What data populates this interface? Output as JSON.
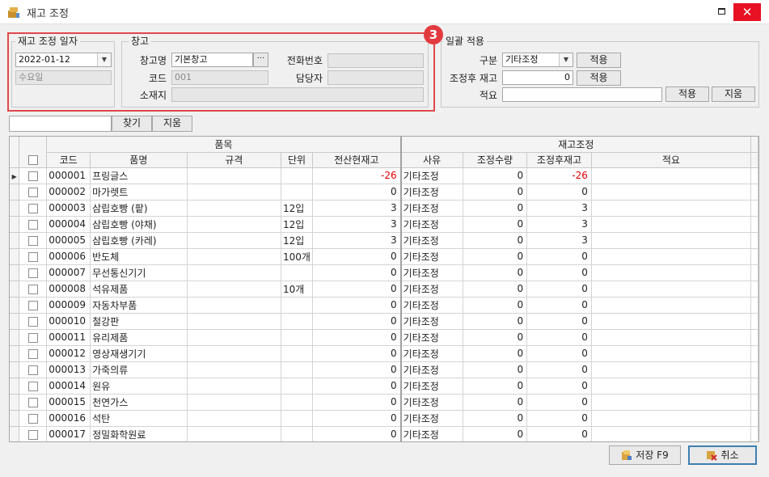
{
  "window": {
    "title": "재고 조정",
    "close_glyph": "✕"
  },
  "date_group": {
    "legend": "재고 조정 일자",
    "date_value": "2022-01-12",
    "weekday": "수요일"
  },
  "warehouse_group": {
    "legend": "창고",
    "name_label": "창고명",
    "name_value": "기본창고",
    "browse_glyph": "···",
    "phone_label": "전화번호",
    "phone_value": "",
    "code_label": "코드",
    "code_value": "001",
    "manager_label": "담당자",
    "manager_value": "",
    "location_label": "소재지",
    "location_value": ""
  },
  "badge": "3",
  "batch_group": {
    "legend": "일괄 적용",
    "category_label": "구분",
    "category_value": "기타조정",
    "apply_label": "적용",
    "after_stock_label": "조정후 재고",
    "after_stock_value": "0",
    "apply2_label": "적용",
    "memo_label": "적요",
    "memo_value": "",
    "apply3_label": "적용",
    "clear_label": "지움"
  },
  "search": {
    "value": "",
    "find_label": "찾기",
    "clear_label": "지움"
  },
  "grid": {
    "group_item": "품목",
    "group_adjust": "재고조정",
    "columns": [
      "코드",
      "품명",
      "규격",
      "단위",
      "전산현재고",
      "사유",
      "조정수량",
      "조정후재고",
      "적요"
    ],
    "rows": [
      {
        "code": "000001",
        "name": "프링글스",
        "spec": "",
        "unit": "",
        "stock": "-26",
        "reason": "기타조정",
        "qty": "0",
        "after": "-26",
        "memo": ""
      },
      {
        "code": "000002",
        "name": "마가렛트",
        "spec": "",
        "unit": "",
        "stock": "0",
        "reason": "기타조정",
        "qty": "0",
        "after": "0",
        "memo": ""
      },
      {
        "code": "000003",
        "name": "삼립호빵 (팥)",
        "spec": "",
        "unit": "12입",
        "stock": "3",
        "reason": "기타조정",
        "qty": "0",
        "after": "3",
        "memo": ""
      },
      {
        "code": "000004",
        "name": "삼립호빵 (야채)",
        "spec": "",
        "unit": "12입",
        "stock": "3",
        "reason": "기타조정",
        "qty": "0",
        "after": "3",
        "memo": ""
      },
      {
        "code": "000005",
        "name": "삼립호빵 (카레)",
        "spec": "",
        "unit": "12입",
        "stock": "3",
        "reason": "기타조정",
        "qty": "0",
        "after": "3",
        "memo": ""
      },
      {
        "code": "000006",
        "name": "반도체",
        "spec": "",
        "unit": "100개",
        "stock": "0",
        "reason": "기타조정",
        "qty": "0",
        "after": "0",
        "memo": ""
      },
      {
        "code": "000007",
        "name": "무선통신기기",
        "spec": "",
        "unit": "",
        "stock": "0",
        "reason": "기타조정",
        "qty": "0",
        "after": "0",
        "memo": ""
      },
      {
        "code": "000008",
        "name": "석유제품",
        "spec": "",
        "unit": "10개",
        "stock": "0",
        "reason": "기타조정",
        "qty": "0",
        "after": "0",
        "memo": ""
      },
      {
        "code": "000009",
        "name": "자동차부품",
        "spec": "",
        "unit": "",
        "stock": "0",
        "reason": "기타조정",
        "qty": "0",
        "after": "0",
        "memo": ""
      },
      {
        "code": "000010",
        "name": "철강판",
        "spec": "",
        "unit": "",
        "stock": "0",
        "reason": "기타조정",
        "qty": "0",
        "after": "0",
        "memo": ""
      },
      {
        "code": "000011",
        "name": "유리제품",
        "spec": "",
        "unit": "",
        "stock": "0",
        "reason": "기타조정",
        "qty": "0",
        "after": "0",
        "memo": ""
      },
      {
        "code": "000012",
        "name": "영상재생기기",
        "spec": "",
        "unit": "",
        "stock": "0",
        "reason": "기타조정",
        "qty": "0",
        "after": "0",
        "memo": ""
      },
      {
        "code": "000013",
        "name": "가죽의류",
        "spec": "",
        "unit": "",
        "stock": "0",
        "reason": "기타조정",
        "qty": "0",
        "after": "0",
        "memo": ""
      },
      {
        "code": "000014",
        "name": "원유",
        "spec": "",
        "unit": "",
        "stock": "0",
        "reason": "기타조정",
        "qty": "0",
        "after": "0",
        "memo": ""
      },
      {
        "code": "000015",
        "name": "천연가스",
        "spec": "",
        "unit": "",
        "stock": "0",
        "reason": "기타조정",
        "qty": "0",
        "after": "0",
        "memo": ""
      },
      {
        "code": "000016",
        "name": "석탄",
        "spec": "",
        "unit": "",
        "stock": "0",
        "reason": "기타조정",
        "qty": "0",
        "after": "0",
        "memo": ""
      },
      {
        "code": "000017",
        "name": "정밀화학원료",
        "spec": "",
        "unit": "",
        "stock": "0",
        "reason": "기타조정",
        "qty": "0",
        "after": "0",
        "memo": ""
      }
    ]
  },
  "footer": {
    "save_label": "저장 F9",
    "cancel_label": "취소"
  },
  "colors": {
    "highlight": "#e0484c",
    "negative": "#e00000",
    "close": "#e81123"
  }
}
